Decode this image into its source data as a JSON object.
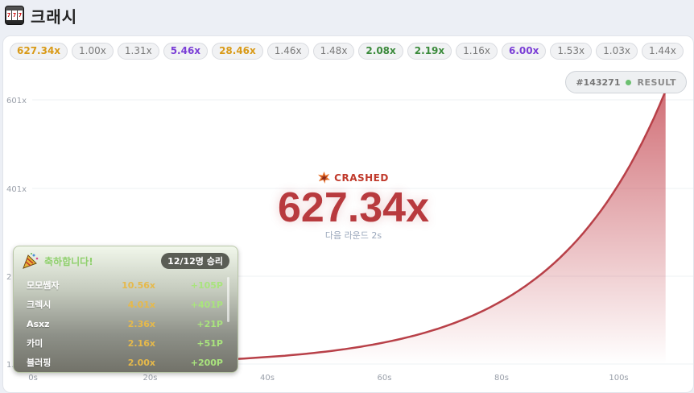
{
  "header": {
    "title": "크래시",
    "icon": "slot-machine-icon"
  },
  "history": [
    {
      "value": "627.34x",
      "tone": "orange"
    },
    {
      "value": "1.00x",
      "tone": "gray"
    },
    {
      "value": "1.31x",
      "tone": "gray"
    },
    {
      "value": "5.46x",
      "tone": "purple"
    },
    {
      "value": "28.46x",
      "tone": "orange"
    },
    {
      "value": "1.46x",
      "tone": "gray"
    },
    {
      "value": "1.48x",
      "tone": "gray"
    },
    {
      "value": "2.08x",
      "tone": "green"
    },
    {
      "value": "2.19x",
      "tone": "green"
    },
    {
      "value": "1.16x",
      "tone": "gray"
    },
    {
      "value": "6.00x",
      "tone": "purple"
    },
    {
      "value": "1.53x",
      "tone": "gray"
    },
    {
      "value": "1.03x",
      "tone": "gray"
    },
    {
      "value": "1.44x",
      "tone": "gray"
    }
  ],
  "result": {
    "round_id": "#143271",
    "label": "RESULT"
  },
  "crash": {
    "status": "CRASHED",
    "multiplier": "627.34x",
    "next_round": "다음 라운드 2s"
  },
  "chart_data": {
    "type": "line",
    "x_ticks": [
      "0s",
      "20s",
      "40s",
      "60s",
      "80s",
      "100s"
    ],
    "y_ticks": [
      "601x",
      "401x",
      "2",
      "1."
    ],
    "curve_end": {
      "t": 108,
      "multiplier": 627.34
    },
    "colors": {
      "line": "#b84048",
      "fill": "#c2404a"
    }
  },
  "winners": {
    "title": "축하합니다!",
    "count": "12/12명 승리",
    "rows": [
      {
        "name": "모모쌤자",
        "mult": "10.56x",
        "points": "+105P"
      },
      {
        "name": "크렉시",
        "mult": "4.01x",
        "points": "+401P"
      },
      {
        "name": "Asxz",
        "mult": "2.36x",
        "points": "+21P"
      },
      {
        "name": "카미",
        "mult": "2.16x",
        "points": "+51P"
      },
      {
        "name": "블러핑",
        "mult": "2.00x",
        "points": "+200P"
      }
    ]
  },
  "colors": {
    "accent": "#b83a3e",
    "win": "#a9e47d",
    "mult": "#e6b94a"
  }
}
